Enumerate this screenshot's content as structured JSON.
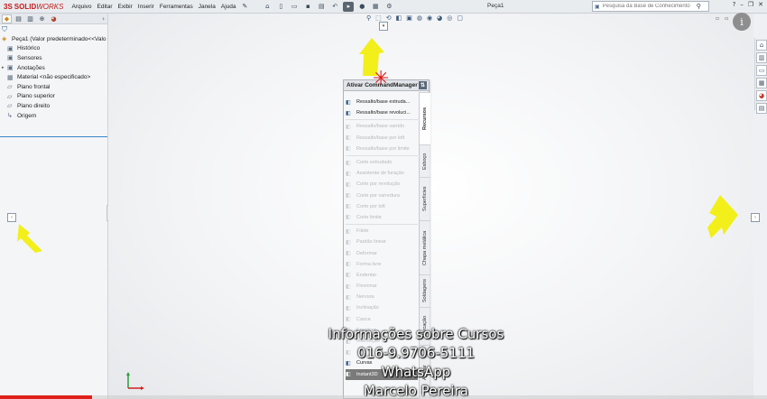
{
  "app": {
    "logo_ds": "3S",
    "logo_solid": "SOLID",
    "logo_works": "WORKS",
    "doc_title": "Peça1"
  },
  "menu": [
    "Arquivo",
    "Editar",
    "Exibir",
    "Inserir",
    "Ferramentas",
    "Janela",
    "Ajuda"
  ],
  "search": {
    "placeholder": "Pesquisa da Base de Conhecimento"
  },
  "tree": {
    "root": "Peça1  (Valor predeterminado<<Valo",
    "items": [
      {
        "label": "Histórico",
        "icon": "history-icon"
      },
      {
        "label": "Sensores",
        "icon": "sensor-icon"
      },
      {
        "label": "Anotações",
        "icon": "annotation-icon"
      },
      {
        "label": "Material <não especificado>",
        "icon": "material-icon"
      },
      {
        "label": "Plano frontal",
        "icon": "plane-icon"
      },
      {
        "label": "Plano superior",
        "icon": "plane-icon"
      },
      {
        "label": "Plano direito",
        "icon": "plane-icon"
      },
      {
        "label": "Origem",
        "icon": "origin-icon"
      }
    ]
  },
  "command_manager": {
    "title": "Ativar CommandManager",
    "items": [
      {
        "label": "Ressalto/base extruda...",
        "enabled": true
      },
      {
        "label": "Ressalto/base revoluci...",
        "enabled": true
      },
      {
        "label": "Ressalto/base varrido",
        "enabled": false
      },
      {
        "label": "Ressalto/base por loft",
        "enabled": false
      },
      {
        "label": "Ressalto/base por limite",
        "enabled": false
      },
      {
        "label": "Corte extrudado",
        "enabled": false
      },
      {
        "label": "Assistente de furação",
        "enabled": false
      },
      {
        "label": "Corte por revolução",
        "enabled": false
      },
      {
        "label": "Corte por varredura",
        "enabled": false
      },
      {
        "label": "Corte por loft",
        "enabled": false
      },
      {
        "label": "Corte limite",
        "enabled": false
      },
      {
        "label": "Filete",
        "enabled": false
      },
      {
        "label": "Padrão linear",
        "enabled": false
      },
      {
        "label": "Deformar",
        "enabled": false
      },
      {
        "label": "Forma livre",
        "enabled": false
      },
      {
        "label": "Endentar",
        "enabled": false
      },
      {
        "label": "Flexionar",
        "enabled": false
      },
      {
        "label": "Nervura",
        "enabled": false
      },
      {
        "label": "Inclinação",
        "enabled": false
      },
      {
        "label": "Casca",
        "enabled": false
      },
      {
        "label": "Envolver",
        "enabled": false
      },
      {
        "label": "Interseção",
        "enabled": false
      },
      {
        "label": "",
        "enabled": false
      },
      {
        "label": "Curvas",
        "enabled": true
      },
      {
        "label": "Instant3D",
        "enabled": true,
        "highlight": true
      }
    ],
    "tabs": [
      "Recursos",
      "Esboço",
      "Superfícies",
      "Chapa metálica",
      "Soldagens",
      "Marcação",
      "Avaliar"
    ]
  },
  "overlay": {
    "line1": "Informações sobre Cursos",
    "line2": "016-9.9706-5111",
    "line3": "WhatsApp",
    "line4": "Marcelo Pereira"
  },
  "video": {
    "progress": 0.12,
    "progress_color": "#e0201b"
  },
  "colors": {
    "annotation_arrow": "#f2ef1a",
    "annotation_star": "#e01818"
  },
  "info_button": "i"
}
